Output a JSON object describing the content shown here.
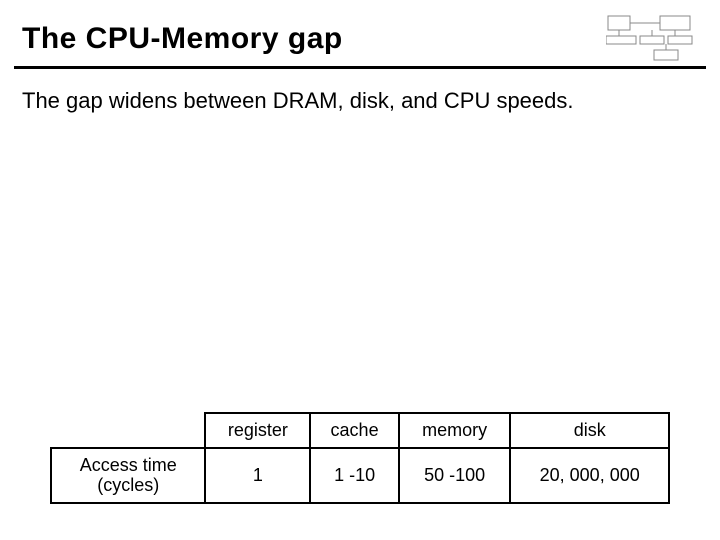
{
  "title": "The CPU-Memory gap",
  "subtitle": "The gap widens between DRAM, disk, and CPU speeds.",
  "table": {
    "row_label_line1": "Access time",
    "row_label_line2": "(cycles)",
    "headers": [
      "register",
      "cache",
      "memory",
      "disk"
    ],
    "values": [
      "1",
      "1 -10",
      "50 -100",
      "20, 000, 000"
    ]
  },
  "chart_data": {
    "type": "table",
    "title": "Access time (cycles)",
    "categories": [
      "register",
      "cache",
      "memory",
      "disk"
    ],
    "values": [
      "1",
      "1-10",
      "50-100",
      "20,000,000"
    ]
  }
}
